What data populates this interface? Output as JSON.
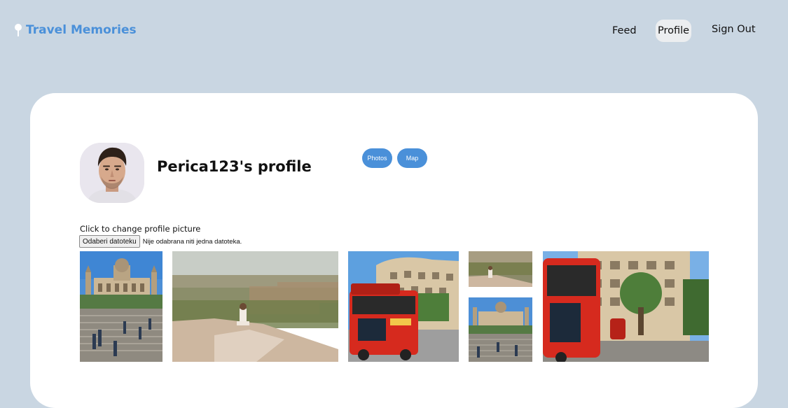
{
  "brand": {
    "name": "Travel Memories",
    "icon": "map-pin-icon",
    "color": "#4a90d9"
  },
  "nav": {
    "feed": "Feed",
    "profile": "Profile",
    "sign_out": "Sign Out",
    "active": "Profile"
  },
  "profile": {
    "title": "Perica123's profile",
    "avatar_icon": "user-avatar"
  },
  "view_toggle": {
    "photos": "Photos",
    "map": "Map"
  },
  "upload": {
    "label": "Click to change profile picture",
    "button": "Odaberi datoteku",
    "status": "Nije odabrana niti jedna datoteka."
  },
  "gallery": {
    "photos": [
      {
        "subject": "palace-with-stairs"
      },
      {
        "subject": "city-overlook-with-person"
      },
      {
        "subject": "red-tour-bus-and-building"
      },
      {
        "subject": "city-overlook-small"
      },
      {
        "subject": "palace-with-stairs-small"
      },
      {
        "subject": "red-bus-and-building-closeup"
      }
    ]
  },
  "colors": {
    "background": "#c9d6e2",
    "card": "#ffffff",
    "accent": "#4a90d9"
  }
}
